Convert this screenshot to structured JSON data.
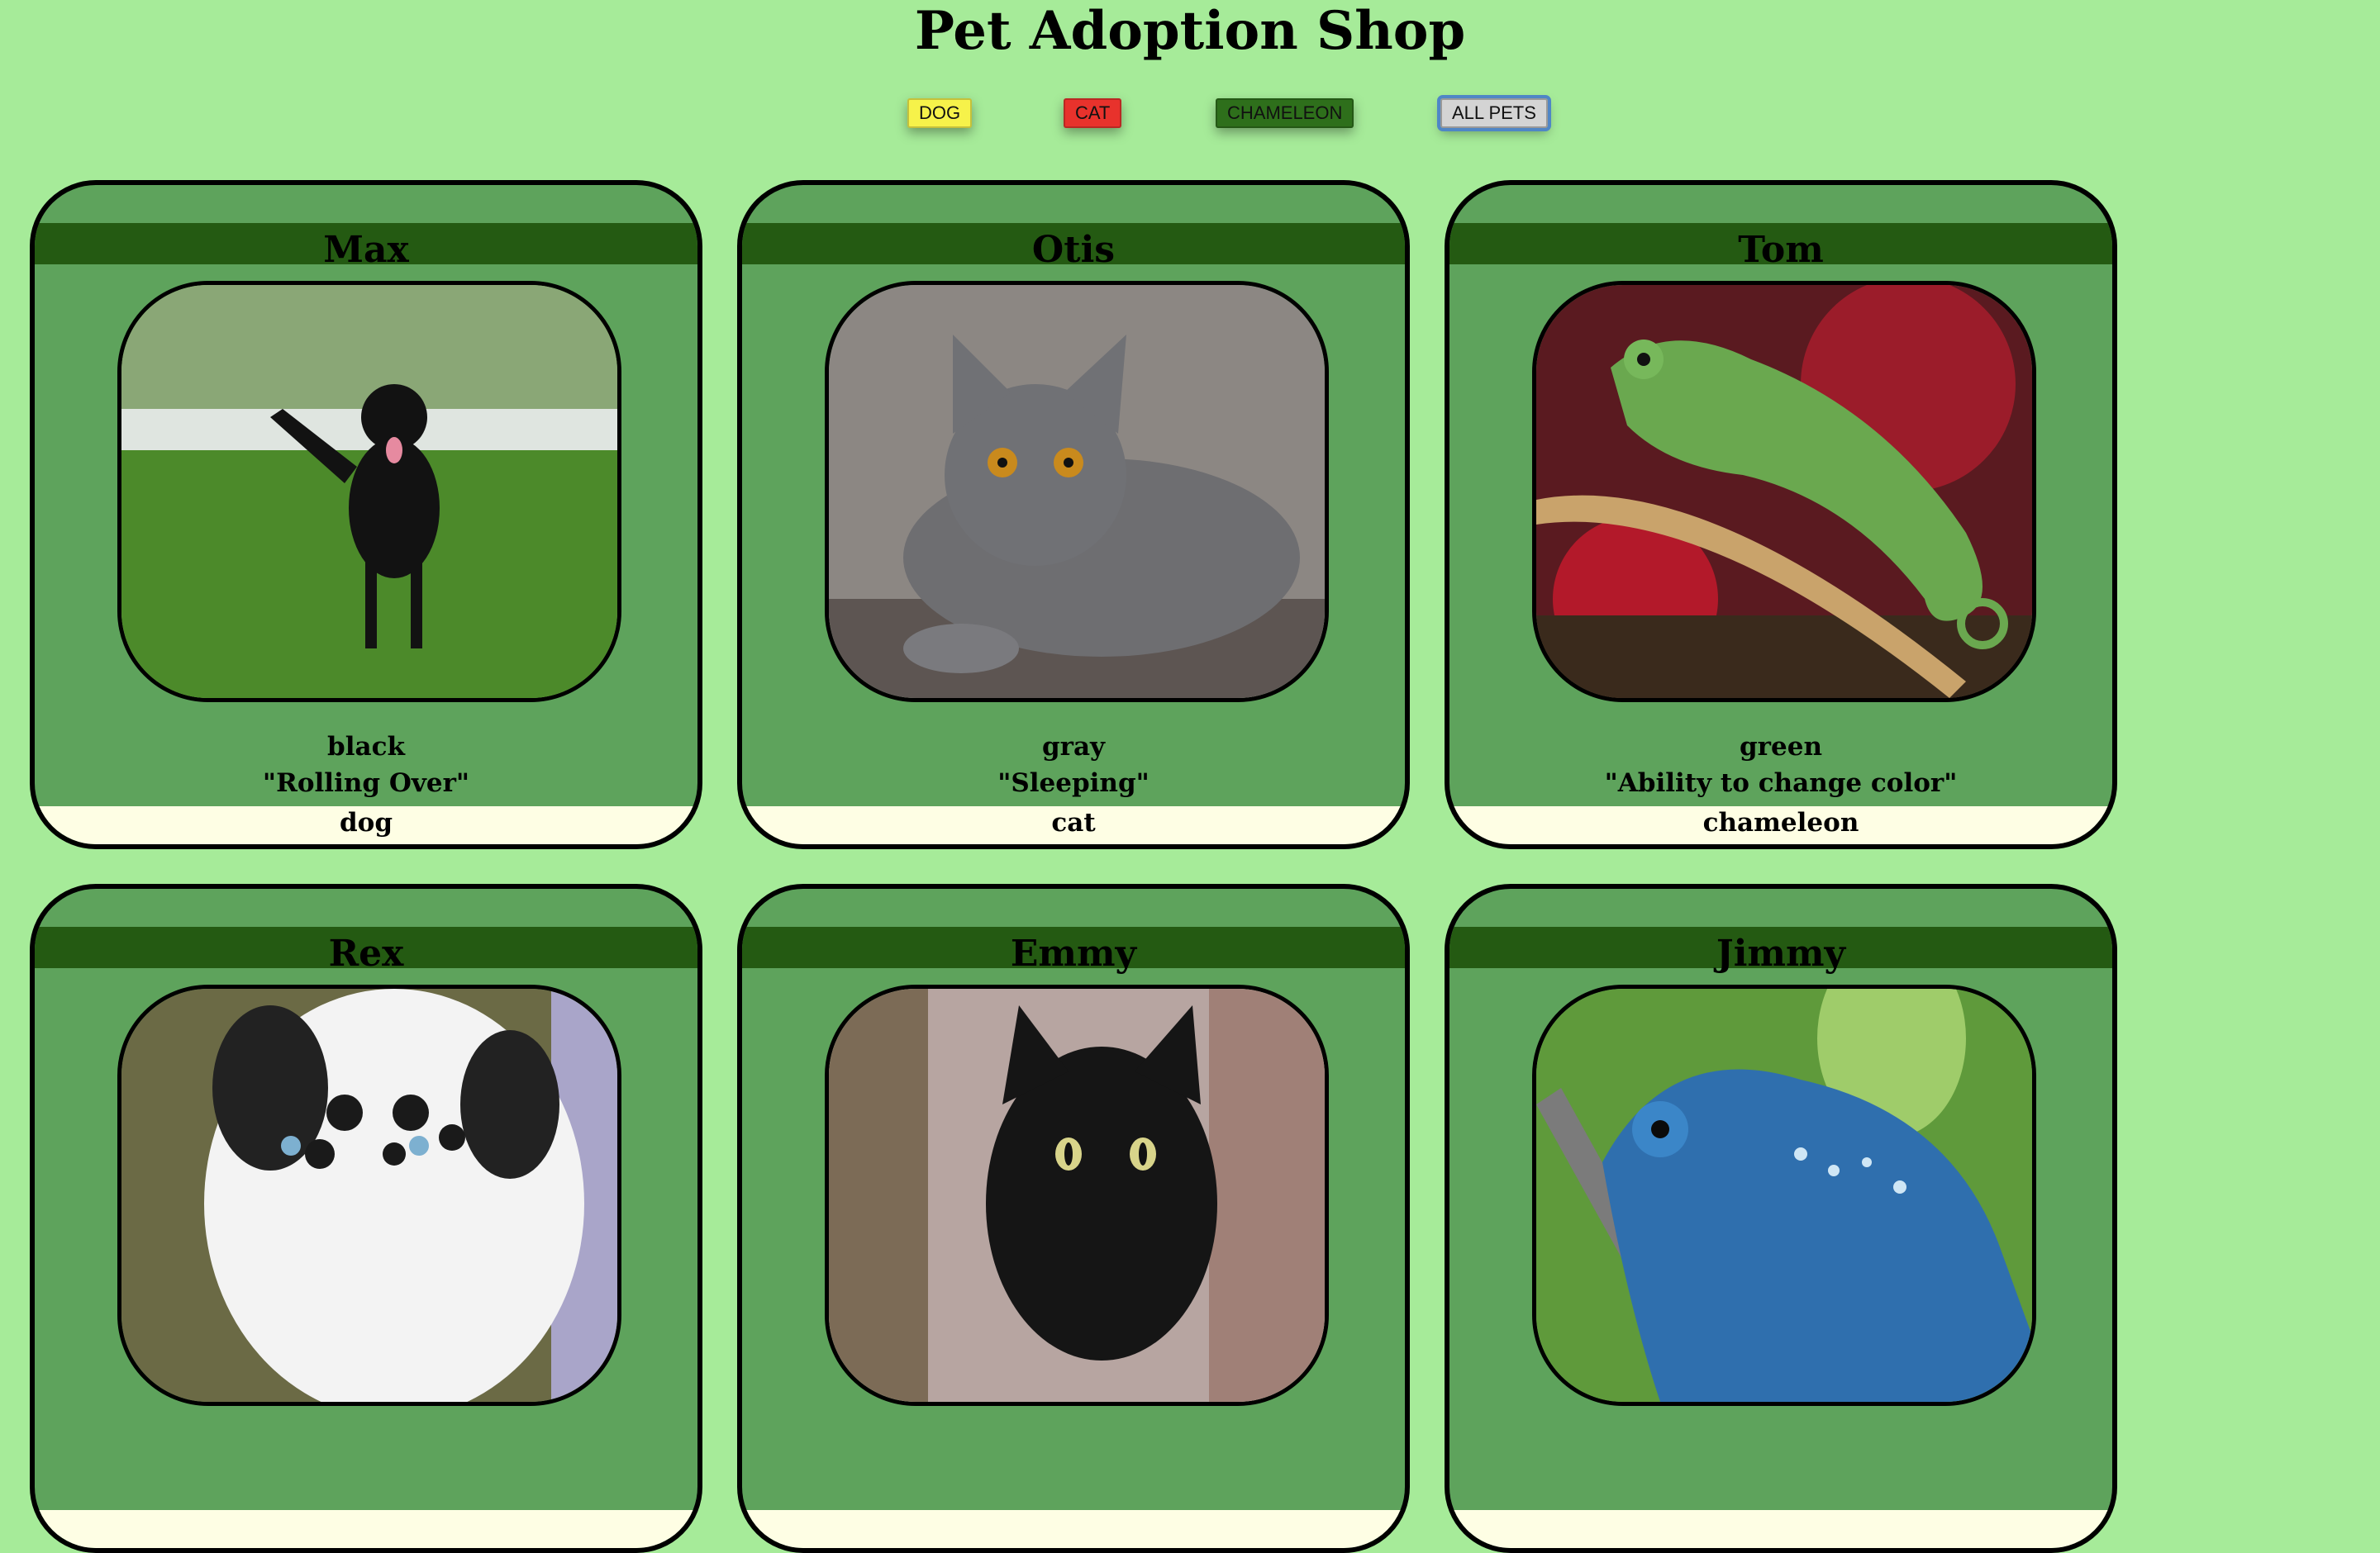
{
  "page": {
    "title": "Pet Adoption Shop"
  },
  "filters": [
    {
      "label": "DOG",
      "color": "#f6f24a",
      "text": "#000"
    },
    {
      "label": "CAT",
      "color": "#e8322c",
      "text": "#000"
    },
    {
      "label": "CHAMELEON",
      "color": "#2e6f1b",
      "text": "#000"
    },
    {
      "label": "ALL PETS",
      "color": "#d4d4d4",
      "text": "#000",
      "active": true
    }
  ],
  "pets": [
    {
      "name": "Max",
      "color": "black",
      "trick": "\"Rolling Over\"",
      "type": "dog",
      "image": "dog-photo"
    },
    {
      "name": "Otis",
      "color": "gray",
      "trick": "\"Sleeping\"",
      "type": "cat",
      "image": "cat-photo"
    },
    {
      "name": "Tom",
      "color": "green",
      "trick": "\"Ability to change color\"",
      "type": "chameleon",
      "image": "chameleon-photo"
    },
    {
      "name": "Rex",
      "color": "",
      "trick": "",
      "type": "",
      "image": "dog-photo"
    },
    {
      "name": "Emmy",
      "color": "",
      "trick": "",
      "type": "",
      "image": "cat-photo"
    },
    {
      "name": "Jimmy",
      "color": "",
      "trick": "",
      "type": "",
      "image": "chameleon-photo"
    }
  ]
}
